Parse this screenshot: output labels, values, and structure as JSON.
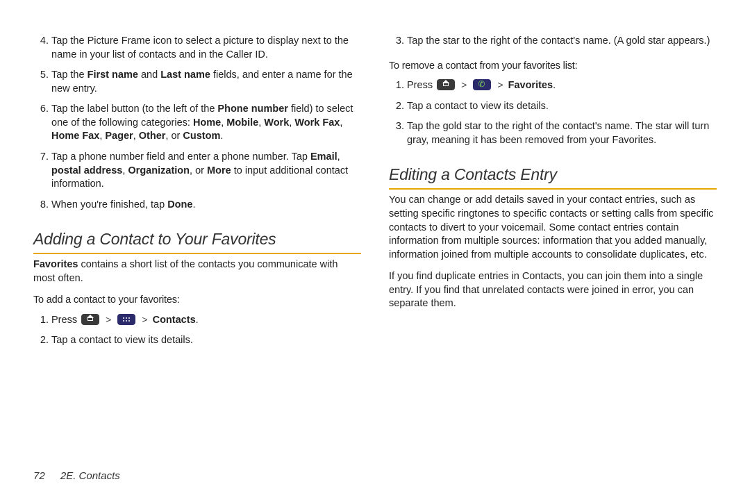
{
  "left": {
    "steps_cont": [
      {
        "n": 4,
        "text_a": "Tap the Picture Frame icon to select a picture to display next to the name in your list of contacts and in the Caller ID."
      },
      {
        "n": 5,
        "text_a": "Tap the ",
        "bold_a": "First name",
        "text_b": " and ",
        "bold_b": "Last name",
        "text_c": " fields, and enter a name for the new entry."
      },
      {
        "n": 6,
        "text_a": "Tap the label button (to the left of the ",
        "bold_a": "Phone number",
        "text_b": " field) to select one of the following categories: ",
        "bold_b": "Home",
        "sep1": ", ",
        "bold_c": "Mobile",
        "sep2": ", ",
        "bold_d": "Work",
        "sep3": ", ",
        "bold_e": "Work Fax",
        "sep4": ", ",
        "bold_f": "Home Fax",
        "sep5": ", ",
        "bold_g": "Pager",
        "sep6": ", ",
        "bold_h": "Other",
        "text_c": ", or ",
        "bold_i": "Custom",
        "text_d": "."
      },
      {
        "n": 7,
        "text_a": "Tap a phone number field and enter a phone number. Tap ",
        "bold_a": "Email",
        "sep1": ", ",
        "bold_b": "postal address",
        "sep2": ", ",
        "bold_c": "Organization",
        "text_b": ", or ",
        "bold_d": "More",
        "text_c": " to input additional contact information."
      },
      {
        "n": 8,
        "text_a": "When you're finished, tap ",
        "bold_a": "Done",
        "text_b": "."
      }
    ],
    "heading1": "Adding a Contact to Your Favorites",
    "fav_intro_bold": "Favorites",
    "fav_intro_rest": " contains a short list of the contacts you communicate with most often.",
    "add_sub": "To add a contact to your favorites:",
    "add_steps": {
      "s1_a": "Press ",
      "s1_end_bold": "Contacts",
      "s1_end": ".",
      "s2": "Tap a contact to view its details."
    }
  },
  "right": {
    "top_step": {
      "n": 3,
      "text": "Tap the star to the right of the contact's name. (A gold star appears.)"
    },
    "remove_sub": "To remove a contact from your favorites list:",
    "remove_steps": {
      "s1_a": "Press ",
      "s1_end_bold": "Favorites",
      "s1_end": ".",
      "s2": "Tap a contact to view its details.",
      "s3": "Tap the gold star to the right of the contact's name. The star will turn gray, meaning it has been removed from your Favorites."
    },
    "heading2": "Editing a Contacts Entry",
    "edit_p1": "You can change or add details saved in your contact entries, such as setting specific ringtones to specific contacts or setting calls from specific contacts to divert to your voicemail. Some contact entries contain information from multiple sources: information that you added manually, information joined from multiple accounts to consolidate duplicates, etc.",
    "edit_p2": "If you find duplicate entries in Contacts, you can join them into a single entry. If you find that unrelated contacts were joined in error, you can separate them."
  },
  "footer": {
    "page": "72",
    "section": "2E. Contacts"
  }
}
